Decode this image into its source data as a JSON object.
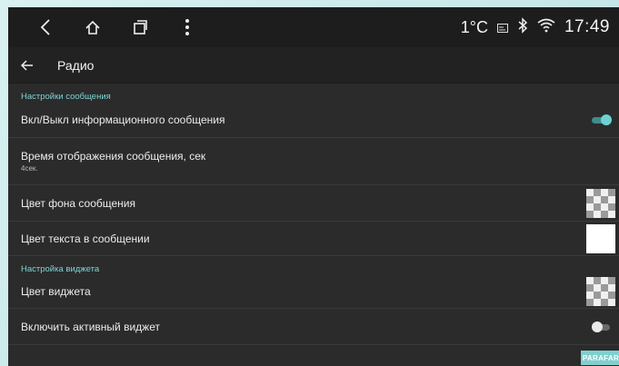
{
  "statusbar": {
    "temperature": "1°C",
    "time": "17:49"
  },
  "appbar": {
    "title": "Радио"
  },
  "sections": {
    "message_settings": "Настройки сообщения",
    "widget_settings": "Настройка виджета"
  },
  "rows": {
    "info_message_toggle": {
      "label": "Вкл/Выкл информационного сообщения",
      "state": "on"
    },
    "display_time": {
      "label": "Время отображения сообщения, сек",
      "value": "4сек."
    },
    "bg_color": {
      "label": "Цвет фона сообщения"
    },
    "text_color": {
      "label": "Цвет текста в сообщении"
    },
    "widget_color": {
      "label": "Цвет виджета"
    },
    "active_widget": {
      "label": "Включить активный виджет",
      "state": "off"
    }
  },
  "colors": {
    "accent": "#6fd2d2",
    "background": "#2b2b2b"
  },
  "watermark": "PARAFAR"
}
